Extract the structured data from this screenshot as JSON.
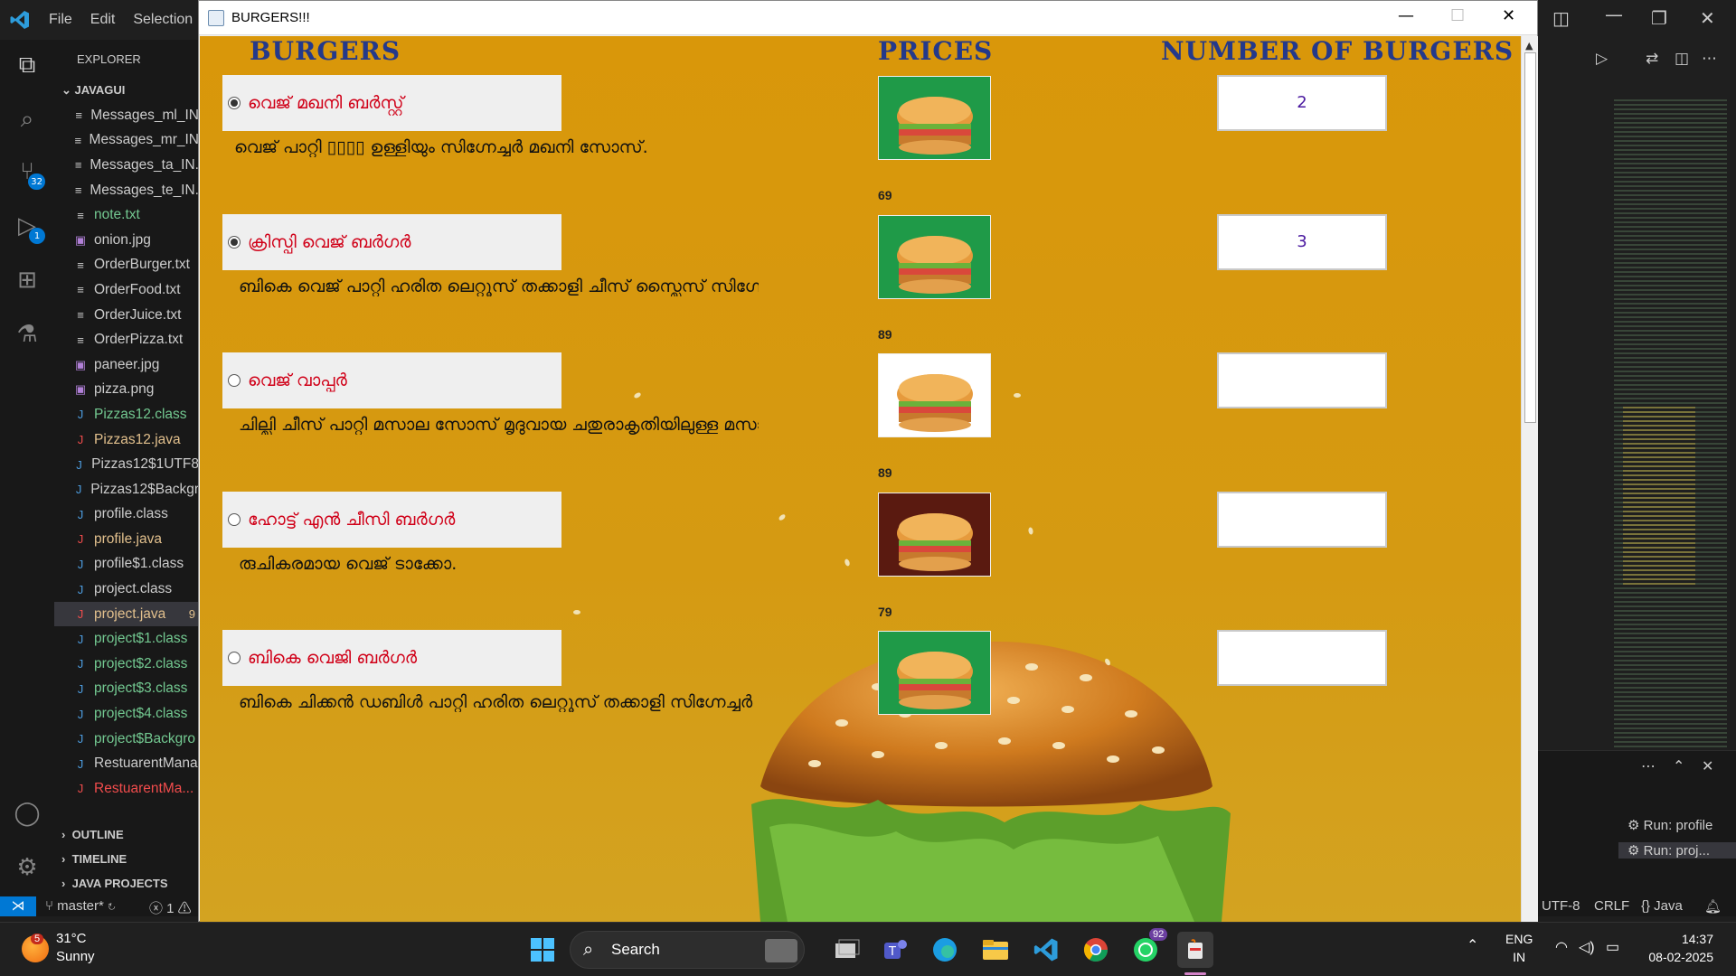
{
  "vscode": {
    "menu": [
      "File",
      "Edit",
      "Selection"
    ],
    "explorer_title": "EXPLORER",
    "folder": "JAVAGUI",
    "files": [
      {
        "name": "Messages_ml_IN",
        "kind": "text",
        "color": "#cccccc"
      },
      {
        "name": "Messages_mr_IN",
        "kind": "text",
        "color": "#cccccc"
      },
      {
        "name": "Messages_ta_IN.",
        "kind": "text",
        "color": "#cccccc"
      },
      {
        "name": "Messages_te_IN.",
        "kind": "text",
        "color": "#cccccc"
      },
      {
        "name": "note.txt",
        "kind": "text",
        "color": "#73c991"
      },
      {
        "name": "onion.jpg",
        "kind": "image",
        "color": "#cccccc"
      },
      {
        "name": "OrderBurger.txt",
        "kind": "text",
        "color": "#cccccc"
      },
      {
        "name": "OrderFood.txt",
        "kind": "text",
        "color": "#cccccc"
      },
      {
        "name": "OrderJuice.txt",
        "kind": "text",
        "color": "#cccccc"
      },
      {
        "name": "OrderPizza.txt",
        "kind": "text",
        "color": "#cccccc"
      },
      {
        "name": "paneer.jpg",
        "kind": "image",
        "color": "#cccccc"
      },
      {
        "name": "pizza.png",
        "kind": "image",
        "color": "#cccccc"
      },
      {
        "name": "Pizzas12.class",
        "kind": "class",
        "color": "#73c991"
      },
      {
        "name": "Pizzas12.java",
        "kind": "java",
        "color": "#e2c08d"
      },
      {
        "name": "Pizzas12$1UTF8",
        "kind": "class",
        "color": "#cccccc"
      },
      {
        "name": "Pizzas12$Backgr",
        "kind": "class",
        "color": "#cccccc"
      },
      {
        "name": "profile.class",
        "kind": "class",
        "color": "#cccccc"
      },
      {
        "name": "profile.java",
        "kind": "java",
        "color": "#e2c08d"
      },
      {
        "name": "profile$1.class",
        "kind": "class",
        "color": "#cccccc"
      },
      {
        "name": "project.class",
        "kind": "class",
        "color": "#cccccc"
      },
      {
        "name": "project.java",
        "kind": "java",
        "color": "#e2c08d",
        "selected": true,
        "badge": "9"
      },
      {
        "name": "project$1.class",
        "kind": "class",
        "color": "#73c991"
      },
      {
        "name": "project$2.class",
        "kind": "class",
        "color": "#73c991"
      },
      {
        "name": "project$3.class",
        "kind": "class",
        "color": "#73c991"
      },
      {
        "name": "project$4.class",
        "kind": "class",
        "color": "#73c991"
      },
      {
        "name": "project$Backgro",
        "kind": "class",
        "color": "#73c991"
      },
      {
        "name": "RestuarentMana",
        "kind": "class",
        "color": "#cccccc"
      },
      {
        "name": "RestuarentMa...",
        "kind": "java",
        "color": "#f14c4c"
      }
    ],
    "sections": [
      "OUTLINE",
      "TIMELINE",
      "JAVA PROJECTS"
    ],
    "activity_badges": {
      "source_control": "32",
      "run": "1"
    },
    "run_items": [
      "Run: profile",
      "Run: proj..."
    ],
    "status": {
      "branch": "master*",
      "errors": "1",
      "encoding": "UTF-8",
      "eol": "CRLF",
      "language": "{} Java"
    }
  },
  "java_window": {
    "title": "BURGERS!!!",
    "headers": {
      "burgers": "BURGERS",
      "prices": "PRICES",
      "count": "NUMBER OF BURGERS"
    },
    "items": [
      {
        "name": "വെജ് മഖനി ബർസ്റ്റ്",
        "selected": true,
        "desc": "വെജ് പാറ്റി ▯▯▯▯ ഉള്ളിയും സിഗ്നേച്ചർ മഖനി സോസ്.",
        "price": "69",
        "qty": "2",
        "img_bg": "#1f9a48"
      },
      {
        "name": "ക്രിസ്പി വെജ് ബർഗർ",
        "selected": true,
        "desc": "ബികെ വെജ് പാറ്റി ഹരിത ലെറ്റൂസ് തക്കാളി ചീസ് സ്ലൈസ് സിഗ്നേച്ചർ",
        "price": "89",
        "qty": "3",
        "img_bg": "#1f9a48"
      },
      {
        "name": "വെജ് വാപ്പർ",
        "selected": false,
        "desc": "ചില്ലി ചീസ് പാറ്റി മസാല സോസ് മൃദുവായ ചതുരാകൃതിയിലുള്ള മസാല",
        "price": "89",
        "qty": "",
        "img_bg": "#ffffff"
      },
      {
        "name": "ഹോട്ട് എൻ ചീസി ബർഗർ",
        "selected": false,
        "desc": "രുചികരമായ വെജ് ടാക്കോ.",
        "price": "79",
        "qty": "",
        "img_bg": "#5a1a10"
      },
      {
        "name": "ബികെ വെജി ബർഗർ",
        "selected": false,
        "desc": "ബികെ ചിക്കൻ ഡബിൾ പാറ്റി ഹരിത ലെറ്റൂസ് തക്കാളി സിഗ്നേച്ചർ സോ",
        "price": "",
        "qty": "",
        "img_bg": "#1f9a48"
      }
    ]
  },
  "taskbar": {
    "weather_temp": "31°C",
    "weather_text": "Sunny",
    "weather_badge": "5",
    "search_label": "Search",
    "whatsapp_badge": "92",
    "lang_line1": "ENG",
    "lang_line2": "IN",
    "time": "14:37",
    "date": "08-02-2025"
  }
}
